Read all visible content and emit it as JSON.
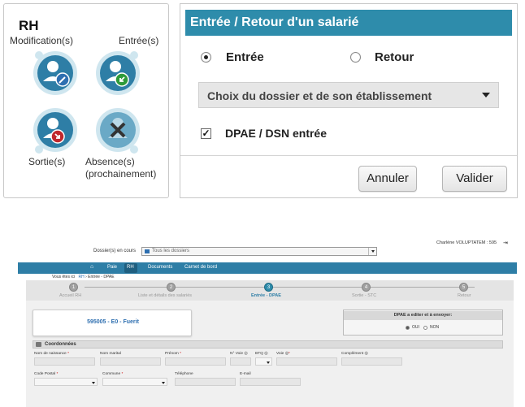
{
  "rh_panel": {
    "title": "RH",
    "items": [
      {
        "label": "Modification(s)",
        "icon": "user-edit-icon"
      },
      {
        "label": "Entrée(s)",
        "icon": "user-enter-icon"
      },
      {
        "label": "Sortie(s)",
        "icon": "user-exit-icon"
      },
      {
        "label": "Absence(s)",
        "label2": "(prochainement)",
        "icon": "user-absence-icon"
      }
    ]
  },
  "dialog": {
    "title": "Entrée / Retour d'un salarié",
    "radio_entree": "Entrée",
    "radio_retour": "Retour",
    "selected": "Entrée",
    "select_value": "Choix du dossier et de son établissement",
    "checkbox_label": "DPAE / DSN entrée",
    "checkbox_checked": true,
    "cancel_label": "Annuler",
    "validate_label": "Valider"
  },
  "app": {
    "user_info": "Charlène VOLUPTATEM : 595",
    "dossier_label": "Dossier(s) en cours",
    "dossier_value": "Tous les dossiers",
    "nav": [
      "Paie",
      "RH",
      "Documents",
      "Carnet de bord"
    ],
    "breadcrumb_prefix": "Vous êtes ici",
    "breadcrumb_items": [
      "RH",
      "Entrée - DPAE"
    ],
    "steps": [
      {
        "num": "1",
        "label": "Accueil RH"
      },
      {
        "num": "2",
        "label": "Liste et détails des salariés"
      },
      {
        "num": "3",
        "label": "Entrée - DPAE"
      },
      {
        "num": "4",
        "label": "Sortie - STC"
      },
      {
        "num": "5",
        "label": "Retour"
      }
    ],
    "active_step": 3,
    "employee_code": "595005 - E0 - Fuerit",
    "dpae_title": "DPAE a editer et à envoyer:",
    "dpae_oui": "OUI",
    "dpae_non": "NON",
    "coord_title": "Coordonnées",
    "fields_row1": [
      "Nom de naissance",
      "Nom marital",
      "Prénom",
      "N° Voie",
      "BTQ",
      "Voie",
      "Complément"
    ],
    "fields_row2": [
      "Code Postal",
      "Commune",
      "Téléphone",
      "E-mail"
    ],
    "required_mark": "*",
    "info_mark": "◎"
  },
  "colors": {
    "accent": "#2e8cab",
    "navbar": "#2e7ea6",
    "edit_badge": "#2e6fb0",
    "enter_badge": "#2e9a3a",
    "exit_badge": "#c0272d"
  }
}
